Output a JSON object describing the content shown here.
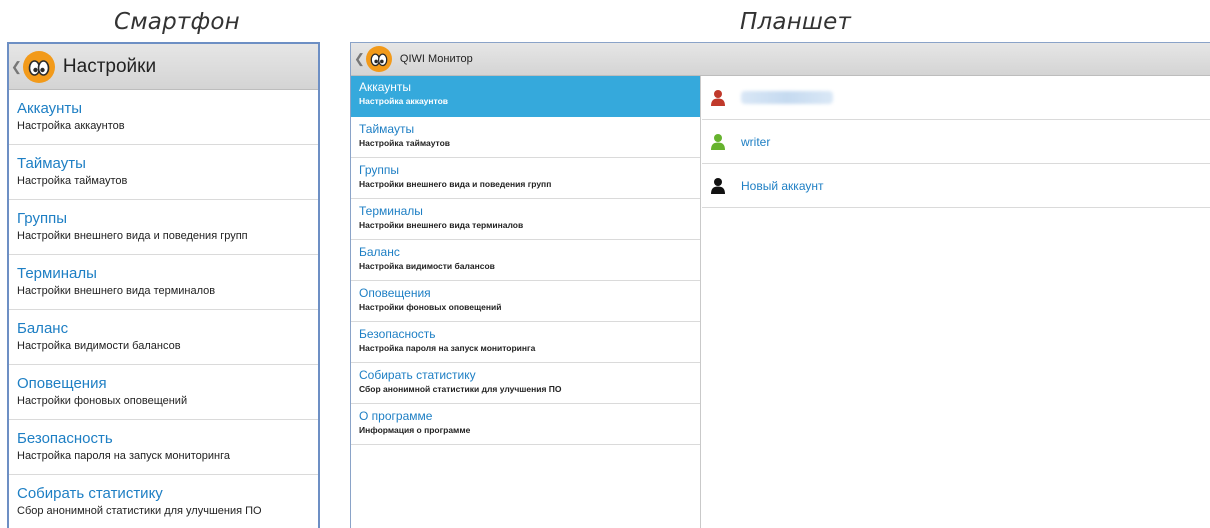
{
  "captions": {
    "phone": "Смартфон",
    "tablet": "Планшет"
  },
  "phone": {
    "title": "Настройки",
    "items": [
      {
        "title": "Аккаунты",
        "subtitle": "Настройка аккаунтов"
      },
      {
        "title": "Таймауты",
        "subtitle": "Настройка таймаутов"
      },
      {
        "title": "Группы",
        "subtitle": "Настройки внешнего вида и поведения групп"
      },
      {
        "title": "Терминалы",
        "subtitle": "Настройки внешнего вида терминалов"
      },
      {
        "title": "Баланс",
        "subtitle": "Настройка видимости балансов"
      },
      {
        "title": "Оповещения",
        "subtitle": "Настройки фоновых оповещений"
      },
      {
        "title": "Безопасность",
        "subtitle": "Настройка пароля на запуск мониторинга"
      },
      {
        "title": "Собирать статистику",
        "subtitle": "Сбор анонимной статистики для улучшения ПО"
      }
    ]
  },
  "tablet": {
    "title": "QIWI Монитор",
    "items": [
      {
        "title": "Аккаунты",
        "subtitle": "Настройка аккаунтов"
      },
      {
        "title": "Таймауты",
        "subtitle": "Настройка таймаутов"
      },
      {
        "title": "Группы",
        "subtitle": "Настройки внешнего вида и поведения групп"
      },
      {
        "title": "Терминалы",
        "subtitle": "Настройки внешнего вида терминалов"
      },
      {
        "title": "Баланс",
        "subtitle": "Настройка видимости балансов"
      },
      {
        "title": "Оповещения",
        "subtitle": "Настройки фоновых оповещений"
      },
      {
        "title": "Безопасность",
        "subtitle": "Настройка пароля на запуск мониторинга"
      },
      {
        "title": "Собирать статистику",
        "subtitle": "Сбор анонимной статистики для улучшения ПО"
      },
      {
        "title": "О программе",
        "subtitle": "Информация о программе"
      }
    ],
    "selected_index": 0,
    "accounts": [
      {
        "name": "",
        "color": "#c0392b",
        "blurred": true
      },
      {
        "name": "writer",
        "color": "#66b32e",
        "blurred": false
      },
      {
        "name": "Новый аккаунт",
        "color": "#111111",
        "blurred": false
      }
    ]
  },
  "icons": {
    "back": "chevron-left-icon",
    "logo": "qiwi-monitor-logo-icon",
    "user": "user-icon"
  },
  "colors": {
    "accent": "#1e7fc4",
    "selected": "#35a9dc",
    "logo": "#f29a1a",
    "frame": "#6d8fc4"
  }
}
